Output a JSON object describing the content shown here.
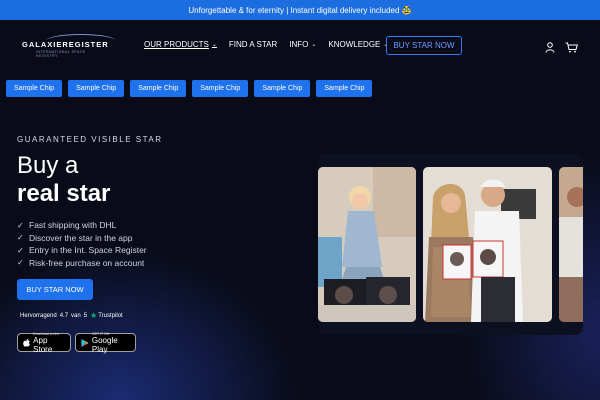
{
  "announcement": "Unforgettable & for eternity | Instant digital delivery included 🥸",
  "brand": {
    "name": "GALAXIEREGISTER",
    "tagline": "INTERNATIONAL SPACE REGISTRY"
  },
  "nav": {
    "items": [
      {
        "label": "OUR PRODUCTS",
        "dropdown": true
      },
      {
        "label": "FIND A STAR",
        "dropdown": false
      },
      {
        "label": "INFO",
        "dropdown": true
      },
      {
        "label": "KNOWLEDGE",
        "dropdown": true
      }
    ],
    "cta": "BUY STAR NOW",
    "icons": [
      "user-icon",
      "cart-icon"
    ]
  },
  "chips": [
    "Sample Chip",
    "Sample Chip",
    "Sample Chip",
    "Sample Chip",
    "Sample Chip",
    "Sample Chip"
  ],
  "hero": {
    "eyebrow": "GUARANTEED VISIBLE STAR",
    "title_line1": "Buy a",
    "title_line2": "real star",
    "features": [
      "Fast shipping with DHL",
      "Discover the star in the app",
      "Entry in the Int. Space Register",
      "Risk-free purchase on account"
    ],
    "cta": "BUY STAR NOW",
    "rating": {
      "label": "Hervorragend",
      "score": "4.7",
      "sep": "van",
      "max": "5",
      "provider": "Trustpilot"
    },
    "store_badges": [
      {
        "small": "Download on the",
        "big": "App Store",
        "icon": "apple-icon"
      },
      {
        "small": "GET IT ON",
        "big": "Google Play",
        "icon": "google-play-icon"
      }
    ]
  },
  "colors": {
    "accent": "#1f72ee",
    "background": "#090b18",
    "trustpilot": "#00b67a"
  }
}
